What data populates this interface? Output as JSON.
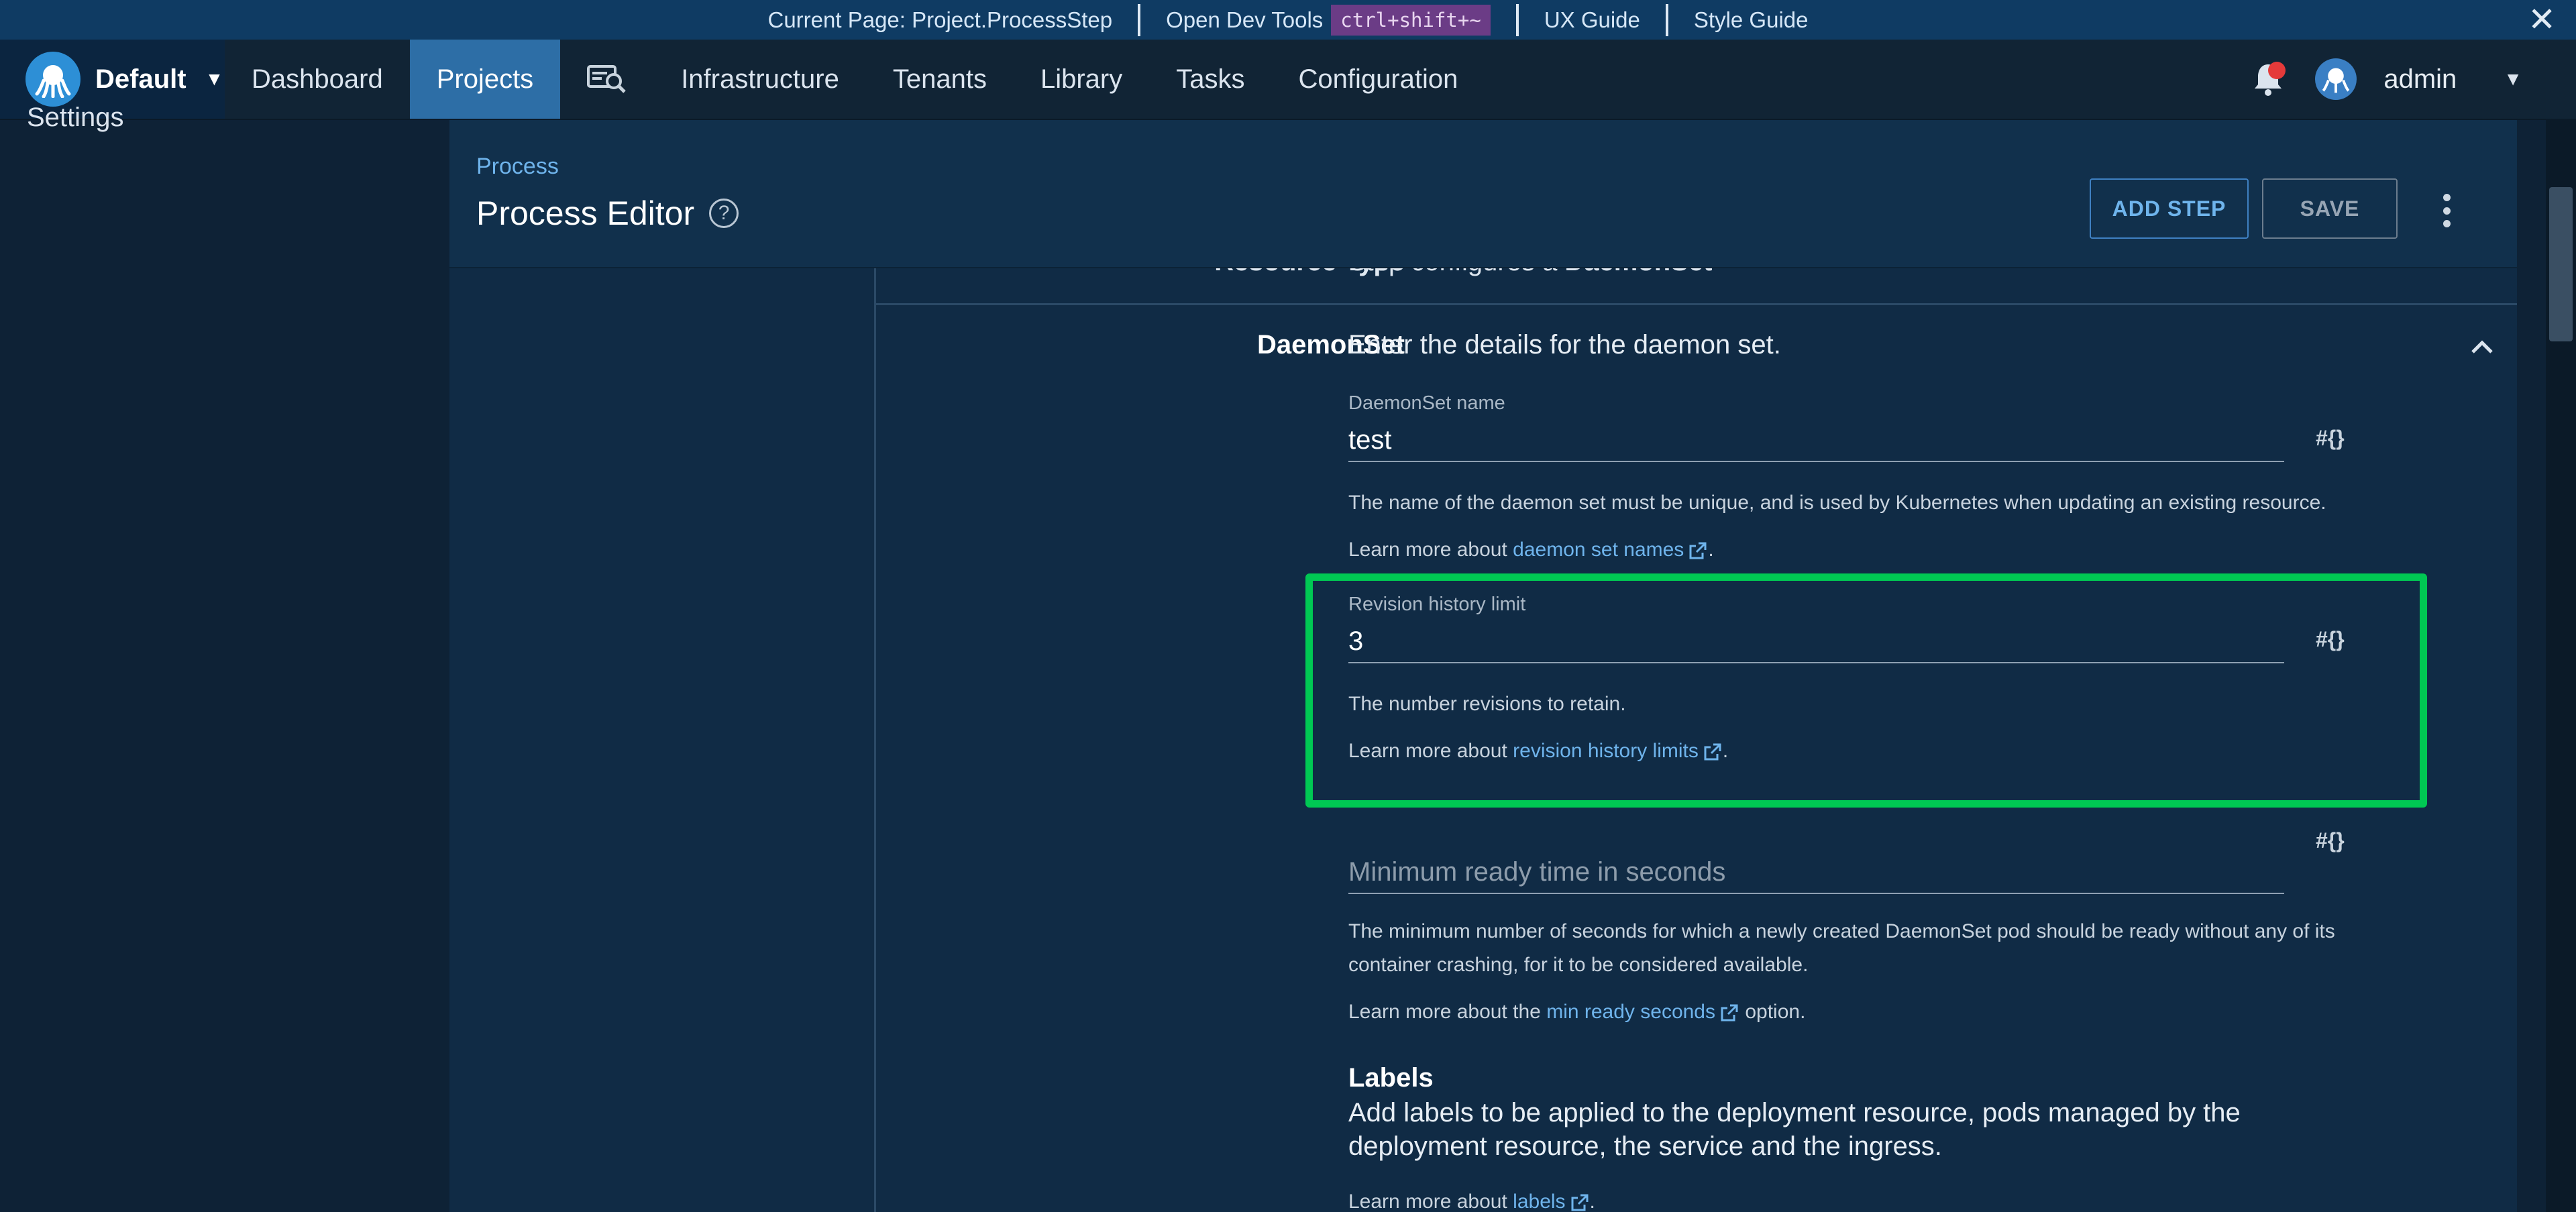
{
  "devbar": {
    "current_page": "Current Page: Project.ProcessStep",
    "dev_tools": "Open Dev Tools",
    "shortcut": "ctrl+shift+~",
    "ux_guide": "UX Guide",
    "style_guide": "Style Guide",
    "close": "✕"
  },
  "nav": {
    "space": "Default",
    "items": [
      "Dashboard",
      "Projects",
      "Infrastructure",
      "Tenants",
      "Library",
      "Tasks",
      "Configuration"
    ],
    "active": "Projects",
    "user": "admin"
  },
  "sidebar": {
    "cut_item": "Settings"
  },
  "header": {
    "breadcrumb": "Process",
    "title": "Process Editor",
    "add_step": "ADD STEP",
    "save": "SAVE"
  },
  "resource_type": {
    "label": "Resource Type",
    "value_prefix": "Step configures a ",
    "value_bold": "DaemonSet"
  },
  "daemonset": {
    "label": "DaemonSet",
    "description": "Enter the details for the daemon set.",
    "name_field": {
      "label": "DaemonSet name",
      "value": "test",
      "help": "The name of the daemon set must be unique, and is used by Kubernetes when updating an existing resource.",
      "learn_prefix": "Learn more about ",
      "learn_link": "daemon set names",
      "learn_suffix": "."
    },
    "revision_field": {
      "label": "Revision history limit",
      "value": "3",
      "help": "The number revisions to retain.",
      "learn_prefix": "Learn more about ",
      "learn_link": "revision history limits",
      "learn_suffix": "."
    },
    "min_ready_field": {
      "placeholder": "Minimum ready time in seconds",
      "help": "The minimum number of seconds for which a newly created DaemonSet pod should be ready without any of its container crashing, for it to be considered available.",
      "learn_prefix": "Learn more about the ",
      "learn_link": "min ready seconds",
      "learn_suffix": " option."
    },
    "var_button": "#{}"
  },
  "labels": {
    "title": "Labels",
    "description": "Add labels to be applied to the deployment resource, pods managed by the deployment resource, the service and the ingress.",
    "learn_prefix": "Learn more about ",
    "learn_link": "labels",
    "learn_suffix": "."
  },
  "colors": {
    "accent": "#2d6ea6",
    "link": "#6fb4ec",
    "highlight": "#00c853",
    "notification": "#e53a3a"
  }
}
